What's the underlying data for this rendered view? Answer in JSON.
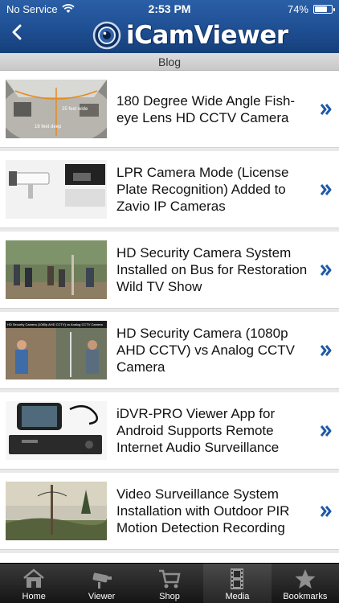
{
  "status": {
    "carrier": "No Service",
    "time": "2:53 PM",
    "battery": "74%",
    "battery_level": 0.74
  },
  "app": {
    "name": "iCamViewer"
  },
  "section": {
    "title": "Blog"
  },
  "posts": [
    {
      "title": "180 Degree Wide Angle Fish-eye Lens HD CCTV Camera",
      "thumb_labels": [
        "25 feet wide",
        "16 feet deep"
      ]
    },
    {
      "title": "LPR Camera Mode (License Plate Recognition) Added to Zavio IP Cameras"
    },
    {
      "title": "HD Security Camera System Installed on Bus for Restoration Wild TV Show"
    },
    {
      "title": "HD Security Camera (1080p AHD CCTV) vs Analog CCTV Camera",
      "thumb_caption": "HD Security Camera (1080p AHD CCTV) vs Analog CCTV Camera"
    },
    {
      "title": "iDVR-PRO Viewer App for Android Supports Remote Internet Audio Surveillance"
    },
    {
      "title": "Video Surveillance System Installation with Outdoor PIR Motion Detection Recording"
    }
  ],
  "tabs": [
    {
      "label": "Home",
      "icon": "home-icon"
    },
    {
      "label": "Viewer",
      "icon": "camera-icon"
    },
    {
      "label": "Shop",
      "icon": "cart-icon"
    },
    {
      "label": "Media",
      "icon": "film-icon",
      "active": true
    },
    {
      "label": "Bookmarks",
      "icon": "star-icon"
    }
  ],
  "colors": {
    "header": "#1f4f93",
    "chevron": "#1f5aa8",
    "tabbar": "#1e1e1e"
  }
}
